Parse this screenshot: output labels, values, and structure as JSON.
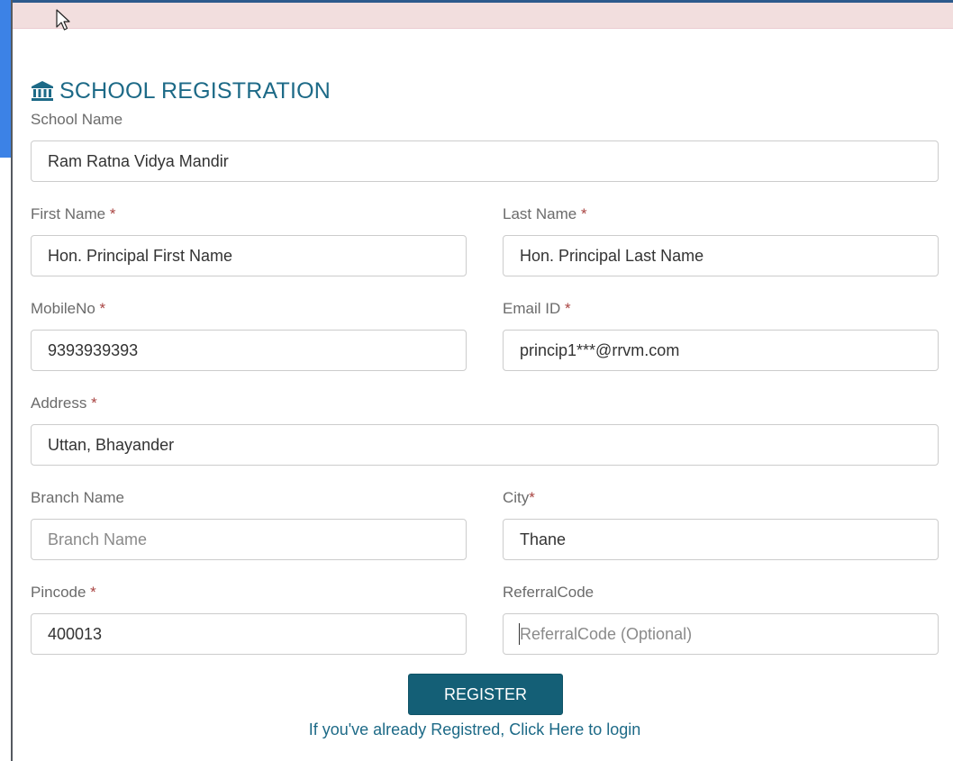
{
  "form": {
    "title": "SCHOOL REGISTRATION",
    "title_icon": "bank-icon",
    "required_mark": "*",
    "fields": {
      "school_name": {
        "label": "School Name",
        "value": "Ram Ratna Vidya Mandir",
        "placeholder": "School Name"
      },
      "first_name": {
        "label": "First Name ",
        "value": "Hon. Principal First Name",
        "placeholder": "First Name"
      },
      "last_name": {
        "label": "Last Name ",
        "value": "Hon. Principal Last Name",
        "placeholder": "Last Name"
      },
      "mobile_no": {
        "label": "MobileNo ",
        "value": "9393939393",
        "placeholder": "MobileNo"
      },
      "email_id": {
        "label": "Email ID ",
        "value": "princip1***@rrvm.com",
        "placeholder": "Email ID"
      },
      "address": {
        "label": "Address ",
        "value": "Uttan, Bhayander",
        "placeholder": "Address"
      },
      "branch_name": {
        "label": "Branch Name",
        "value": "",
        "placeholder": "Branch Name"
      },
      "city": {
        "label": "City",
        "value": "Thane",
        "placeholder": "City"
      },
      "pincode": {
        "label": "Pincode ",
        "value": "400013",
        "placeholder": "Pincode"
      },
      "referral_code": {
        "label": "ReferralCode",
        "value": "",
        "placeholder": "ReferralCode (Optional)"
      }
    },
    "register_label": "REGISTER",
    "login_link_label": "If you've already Registred, Click Here to login"
  },
  "colors": {
    "accent": "#1d6a87",
    "button": "#145f76",
    "alert_bg": "#f2dede",
    "required": "#a94442"
  }
}
